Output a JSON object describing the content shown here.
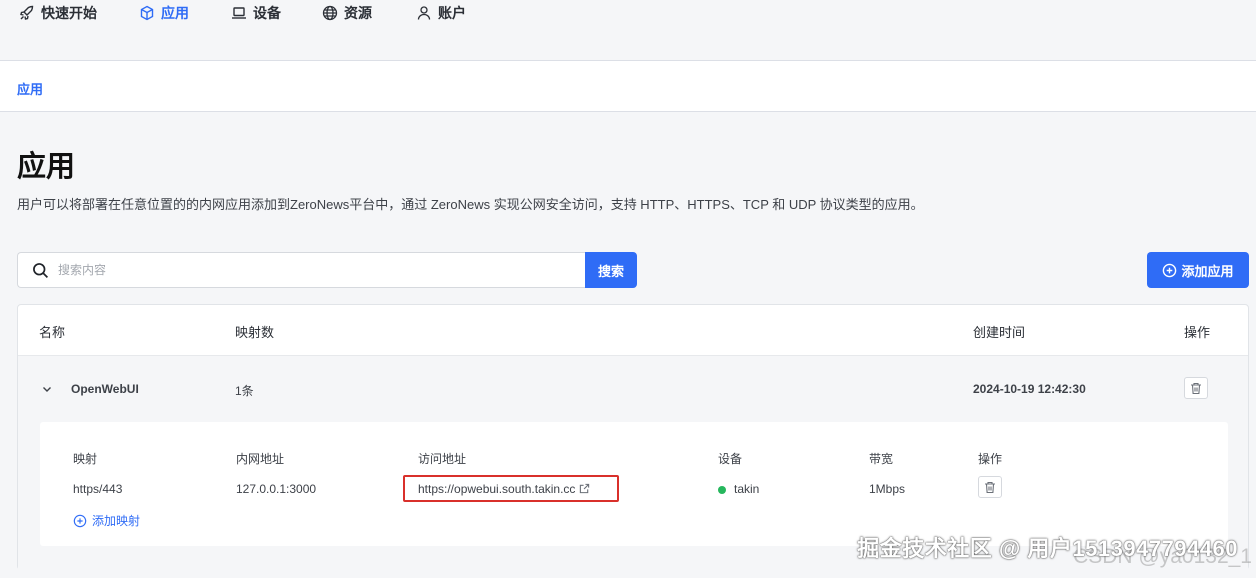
{
  "nav": {
    "items": [
      {
        "label": "快速开始",
        "icon": "rocket-icon"
      },
      {
        "label": "应用",
        "icon": "cube-icon",
        "active": true
      },
      {
        "label": "设备",
        "icon": "laptop-icon"
      },
      {
        "label": "资源",
        "icon": "globe-icon"
      },
      {
        "label": "账户",
        "icon": "user-icon"
      }
    ]
  },
  "subnav": {
    "tab": "应用"
  },
  "page": {
    "title": "应用",
    "description": "用户可以将部署在任意位置的的内网应用添加到ZeroNews平台中，通过 ZeroNews 实现公网安全访问，支持 HTTP、HTTPS、TCP 和 UDP 协议类型的应用。"
  },
  "search": {
    "placeholder": "搜索内容",
    "button": "搜索"
  },
  "add_app": {
    "label": "添加应用"
  },
  "table": {
    "headers": {
      "name": "名称",
      "mappings": "映射数",
      "created": "创建时间",
      "actions": "操作"
    },
    "rows": [
      {
        "name": "OpenWebUI",
        "mappings": "1条",
        "created": "2024-10-19 12:42:30",
        "detail": {
          "headers": {
            "mapping": "映射",
            "internal": "内网地址",
            "access": "访问地址",
            "device": "设备",
            "bandwidth": "带宽",
            "actions": "操作"
          },
          "rows": [
            {
              "mapping": "https/443",
              "internal": "127.0.0.1:3000",
              "access": "https://opwebui.south.takin.cc",
              "device": "takin",
              "bandwidth": "1Mbps"
            }
          ],
          "add_mapping": "添加映射"
        }
      }
    ]
  },
  "colors": {
    "accent": "#2f6cf6",
    "highlight": "#d9302b",
    "online": "#26b75d"
  },
  "watermark": {
    "line1": "掘金技术社区 @ 用户1513947794460",
    "line2": "CSDN @ya0132_1"
  }
}
